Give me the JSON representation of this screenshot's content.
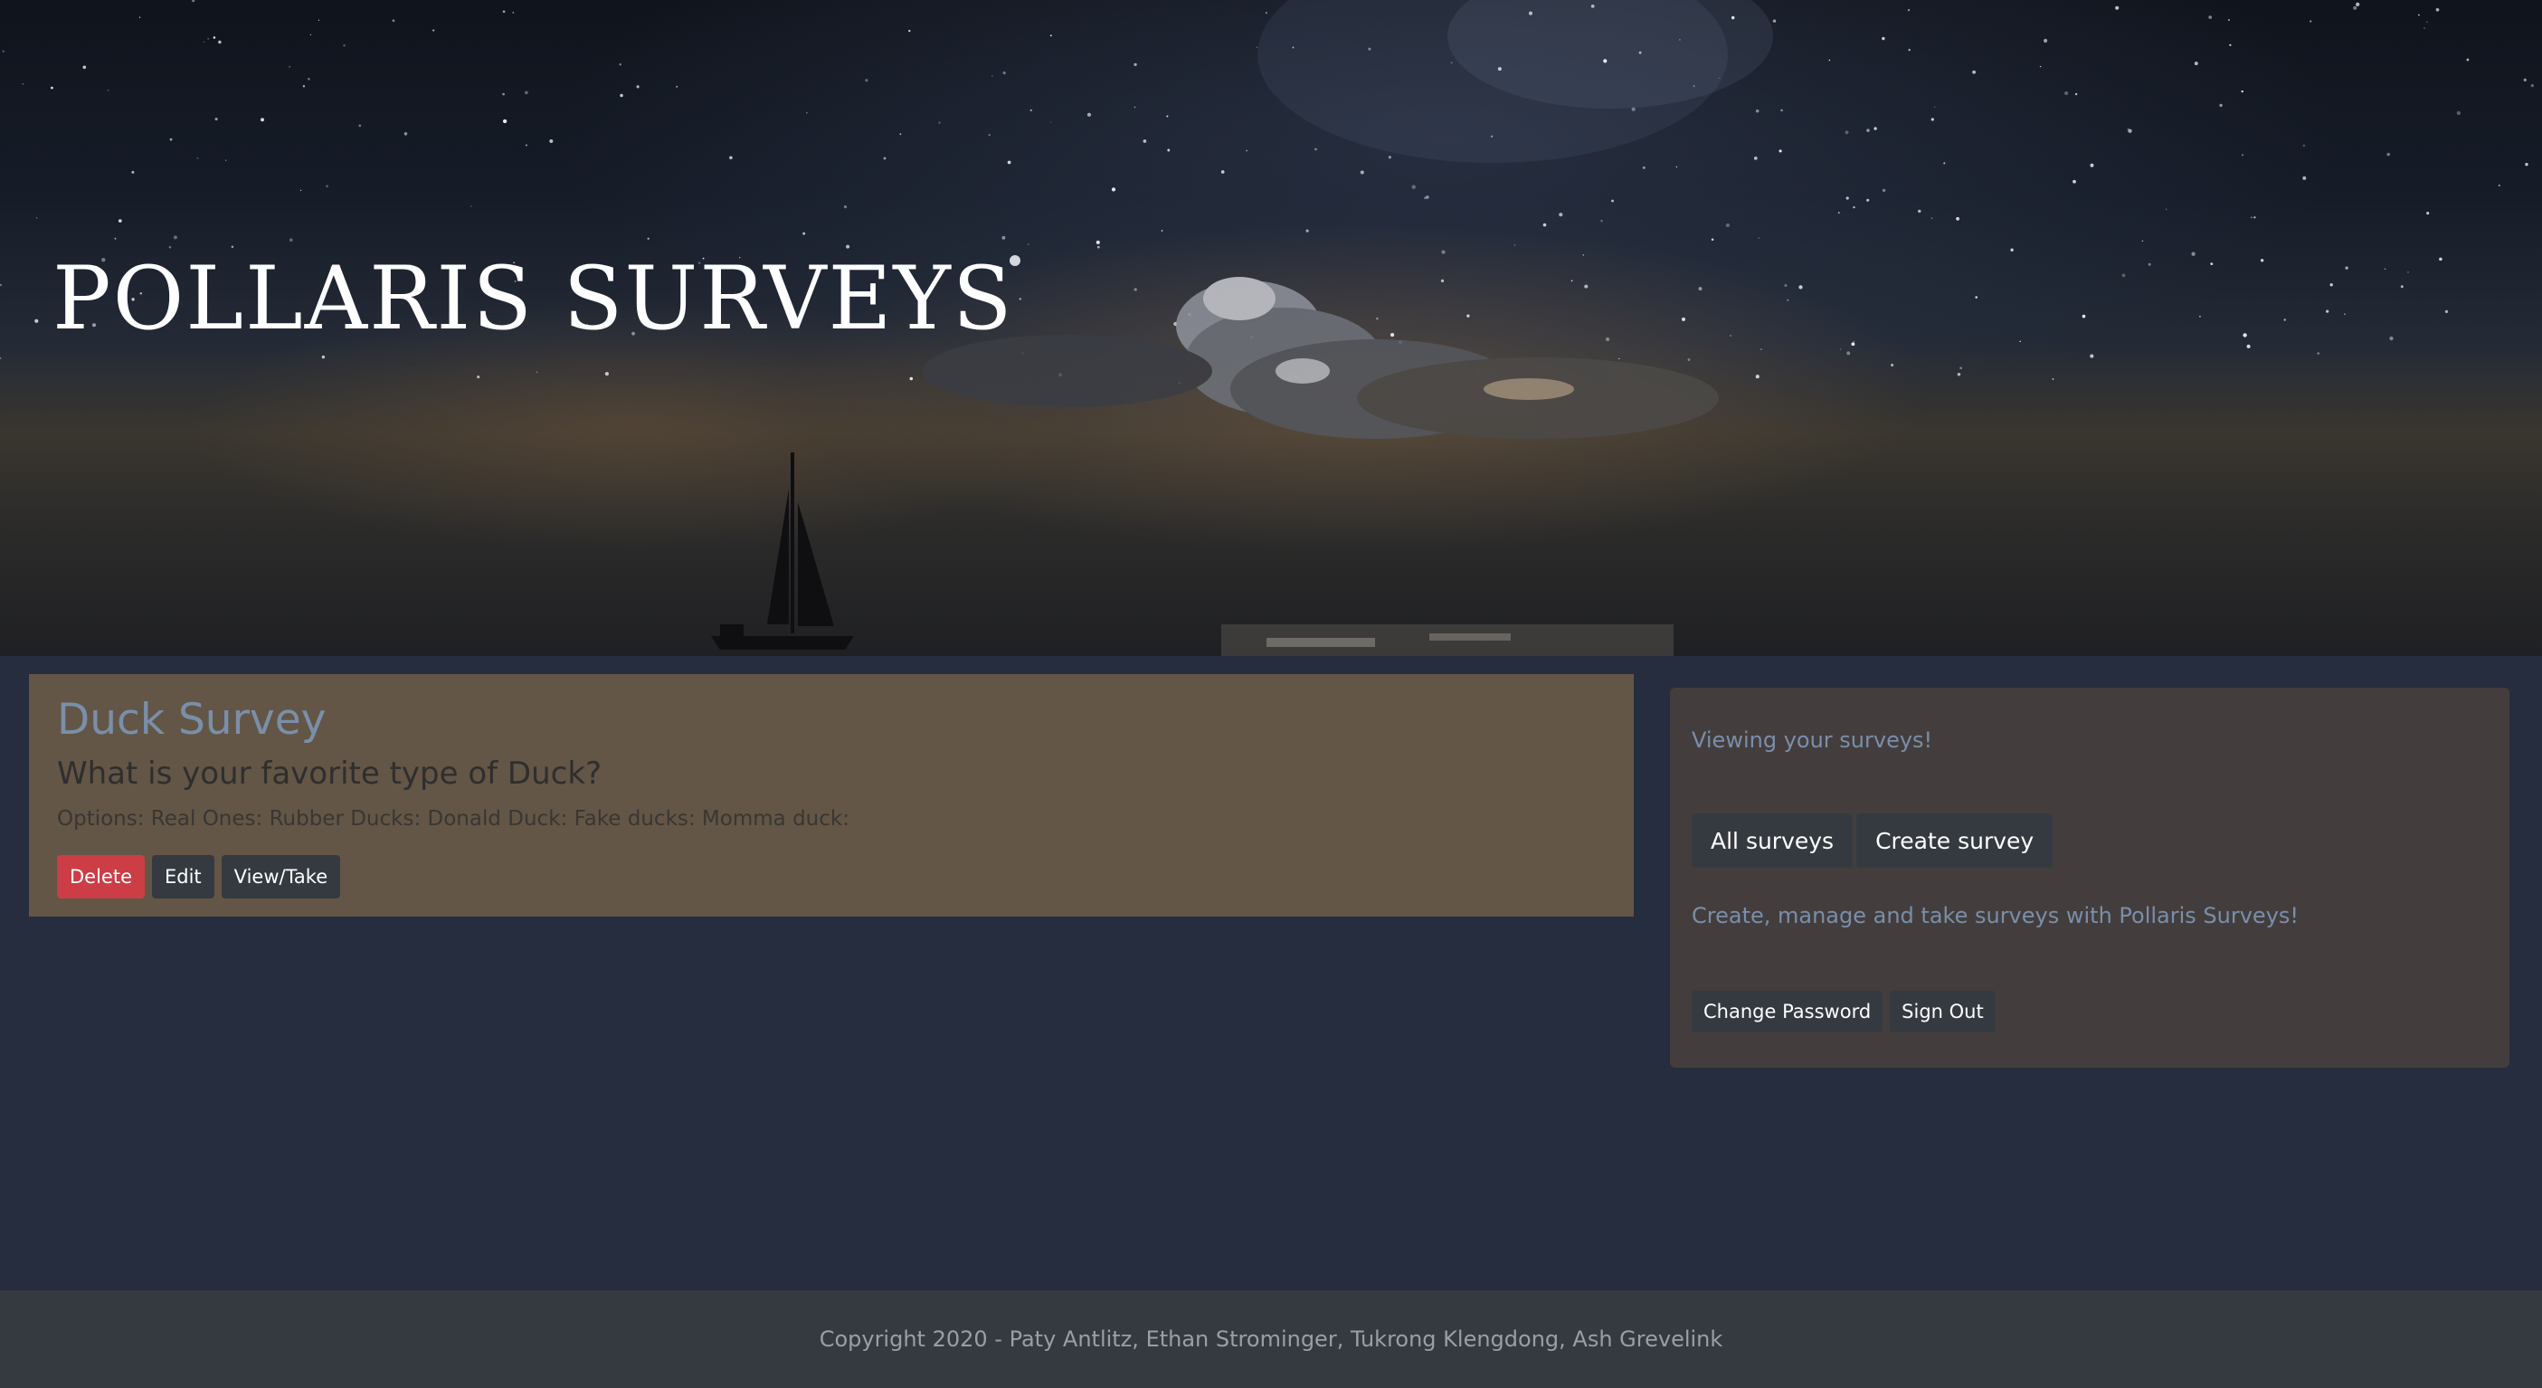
{
  "hero": {
    "title": "POLLARIS SURVEYS"
  },
  "survey": {
    "title": "Duck Survey",
    "question": "What is your favorite type of Duck?",
    "options_text": "Options: Real Ones: Rubber Ducks: Donald Duck: Fake ducks: Momma duck:",
    "actions": {
      "delete_label": "Delete",
      "edit_label": "Edit",
      "view_label": "View/Take"
    }
  },
  "sidebar": {
    "viewing_text": "Viewing your surveys!",
    "nav": {
      "all_label": "All surveys",
      "create_label": "Create survey"
    },
    "tagline": "Create, manage and take surveys with Pollaris Surveys!",
    "account": {
      "change_password_label": "Change Password",
      "sign_out_label": "Sign Out"
    }
  },
  "footer": {
    "copyright": "Copyright 2020 - Paty Antlitz, Ethan Strominger, Tukrong Klengdong, Ash Grevelink"
  },
  "colors": {
    "page_background": "#262d3e",
    "card_background": "#635646",
    "panel_background": "#433e3d",
    "accent_text": "#7b8ea9",
    "danger": "#cc3d46",
    "dark_button": "#343a40",
    "footer_background": "#343a40"
  }
}
